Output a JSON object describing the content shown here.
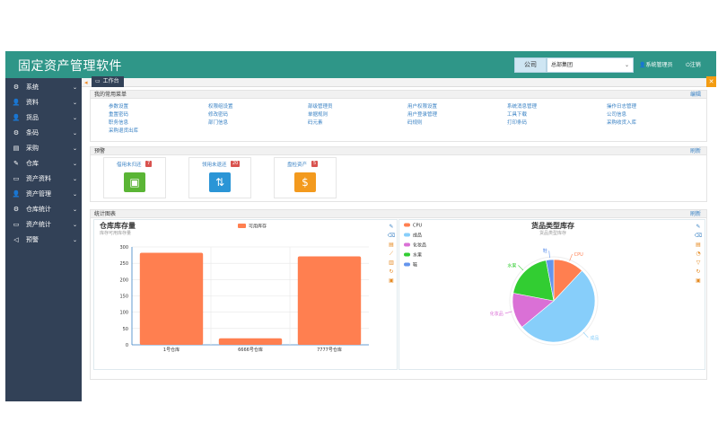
{
  "app": {
    "title": "固定资产管理软件",
    "company_label": "公司",
    "company_value": "总部集团",
    "user": "系统管理员",
    "logout": "注销"
  },
  "sidebar": {
    "items": [
      {
        "label": "系统",
        "icon": "gear-icon",
        "glyph": "⚙"
      },
      {
        "label": "资料",
        "icon": "user-icon",
        "glyph": "👤"
      },
      {
        "label": "货品",
        "icon": "user-icon",
        "glyph": "👤"
      },
      {
        "label": "条码",
        "icon": "gear-icon",
        "glyph": "⚙"
      },
      {
        "label": "采购",
        "icon": "card-icon",
        "glyph": "▤"
      },
      {
        "label": "仓库",
        "icon": "edit-icon",
        "glyph": "✎"
      },
      {
        "label": "资产资料",
        "icon": "monitor-icon",
        "glyph": "▭"
      },
      {
        "label": "资产管理",
        "icon": "user-icon",
        "glyph": "👤"
      },
      {
        "label": "仓库统计",
        "icon": "gear-icon",
        "glyph": "⚙"
      },
      {
        "label": "资产统计",
        "icon": "monitor-icon",
        "glyph": "▭"
      },
      {
        "label": "预警",
        "icon": "volume-icon",
        "glyph": "◁"
      }
    ]
  },
  "tabs": {
    "active": "工作台",
    "close": "✕",
    "back": "◂"
  },
  "menu_panel": {
    "title": "我的常用菜单",
    "action": "编辑",
    "links": [
      [
        "参数设置",
        "权限组设置",
        "部级管理员",
        "用户权限设置",
        "系统消息管理",
        "操作日志管理"
      ],
      [
        "重置密码",
        "修改密码",
        "单据规则",
        "用户登录管理",
        "工具下载",
        "公司信息"
      ],
      [
        "职务信息",
        "部门信息",
        "码元素",
        "码规则",
        "打印条码",
        "采购收货入库"
      ],
      [
        "采购退货出库"
      ]
    ]
  },
  "alert_panel": {
    "title": "预警",
    "action": "刷新",
    "cards": [
      {
        "label": "借用未归还",
        "count": "7",
        "icon": "box-icon",
        "color": "#5ab535"
      },
      {
        "label": "领用未退还",
        "count": "20",
        "icon": "transfer-icon",
        "color": "#2b95d6"
      },
      {
        "label": "盘检资产",
        "count": "5",
        "icon": "money-bag-icon",
        "color": "#f39a1e"
      }
    ]
  },
  "stats_panel": {
    "title": "统计图表",
    "action": "刷新"
  },
  "chart_data": [
    {
      "type": "bar",
      "title": "仓库库存量",
      "subtitle": "库存可用库存量",
      "categories": [
        "1号仓库",
        "6666号仓库",
        "7777号仓库"
      ],
      "series": [
        {
          "name": "可用库存",
          "values": [
            282,
            20,
            271
          ]
        }
      ],
      "ylim": [
        0,
        300
      ],
      "yticks": [
        0,
        50,
        100,
        150,
        200,
        250,
        300
      ],
      "legend": "top-center",
      "colors": {
        "bar": "#ff7f50",
        "axis": "#3a82c4"
      }
    },
    {
      "type": "pie",
      "title": "货品类型库存",
      "subtitle": "货品类型库存",
      "slices": [
        {
          "name": "CPU",
          "value": 12,
          "color": "#ff7f50"
        },
        {
          "name": "成品",
          "value": 52,
          "color": "#87cefa"
        },
        {
          "name": "化妆品",
          "value": 14,
          "color": "#da70d6"
        },
        {
          "name": "水果",
          "value": 19,
          "color": "#32cd32"
        },
        {
          "name": "鞋",
          "value": 3,
          "color": "#6495ed"
        }
      ],
      "legend": "top-left"
    }
  ],
  "toolbar_icons": [
    "mark-icon",
    "erase-icon",
    "data-view-icon",
    "line-icon",
    "bar-icon",
    "restore-icon",
    "save-icon"
  ],
  "toolbar_icons_pie": [
    "mark-icon",
    "erase-icon",
    "data-view-icon",
    "pie-icon",
    "funnel-icon",
    "restore-icon",
    "save-icon"
  ]
}
